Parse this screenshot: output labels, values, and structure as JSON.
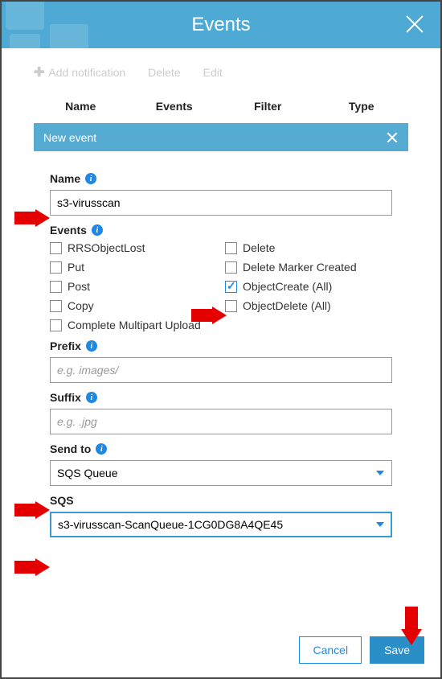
{
  "header": {
    "title": "Events"
  },
  "toolbar": {
    "add_label": "Add notification",
    "delete_label": "Delete",
    "edit_label": "Edit"
  },
  "table": {
    "headers": {
      "name": "Name",
      "events": "Events",
      "filter": "Filter",
      "type": "Type"
    },
    "new_event_label": "New event"
  },
  "form": {
    "name_label": "Name",
    "name_value": "s3-virusscan",
    "events_label": "Events",
    "events_options": {
      "rrs": "RRSObjectLost",
      "del": "Delete",
      "put": "Put",
      "dmc": "Delete Marker Created",
      "post": "Post",
      "ocall": "ObjectCreate (All)",
      "copy": "Copy",
      "odall": "ObjectDelete (All)",
      "cmp": "Complete Multipart Upload"
    },
    "prefix_label": "Prefix",
    "prefix_placeholder": "e.g. images/",
    "suffix_label": "Suffix",
    "suffix_placeholder": "e.g. .jpg",
    "sendto_label": "Send to",
    "sendto_value": "SQS Queue",
    "sqs_label": "SQS",
    "sqs_value": "s3-virusscan-ScanQueue-1CG0DG8A4QE45"
  },
  "footer": {
    "cancel": "Cancel",
    "save": "Save"
  }
}
